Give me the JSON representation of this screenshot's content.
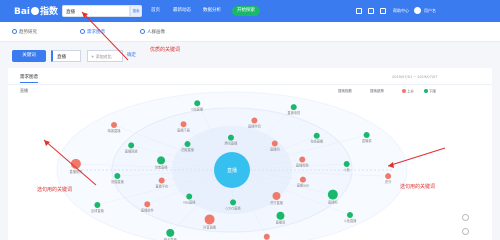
{
  "topbar": {
    "logo_text": "Baidu 指数",
    "search_value": "直播",
    "search_button": "搜索",
    "nav": [
      "首页",
      "最新动态",
      "数据分析"
    ],
    "cta": "开始探索",
    "help": "帮助中心",
    "user": "用户名"
  },
  "subnav": {
    "items": [
      "趋势研究",
      "需求图谱",
      "人群画像"
    ]
  },
  "keywords": {
    "button": "关键词",
    "tag": "直播",
    "add_placeholder": "+ 添加对比",
    "confirm": "确定"
  },
  "panel": {
    "tab": "需求图谱",
    "subtitle": "直播",
    "date_range": "2019/07/01 ~ 2019/07/07",
    "legend": [
      "搜索指数",
      "搜索趋势"
    ],
    "legend_up": "上升",
    "legend_down": "下降"
  },
  "annotations": {
    "top": "优质的关键词",
    "left": "选句用的关键词",
    "right": "选句用的关键词"
  },
  "colors": {
    "brand": "#3a7bf0",
    "rise": "#f07a6a",
    "fall": "#1bb86c",
    "annotation": "#e03030"
  },
  "graph": {
    "center": "直播",
    "nodes": [
      {
        "label": "直播app",
        "trend": "rise",
        "size": 3
      },
      {
        "label": "直播吧",
        "trend": "fall",
        "size": 5
      },
      {
        "label": "斗鱼直播",
        "trend": "fall",
        "size": 3
      },
      {
        "label": "虎牙直播",
        "trend": "rise",
        "size": 4
      },
      {
        "label": "直播间",
        "trend": "fall",
        "size": 4
      },
      {
        "label": "体育直播",
        "trend": "rise",
        "size": 3
      },
      {
        "label": "cctv5直播",
        "trend": "fall",
        "size": 3
      },
      {
        "label": "抖音直播",
        "trend": "rise",
        "size": 5
      },
      {
        "label": "快手直播",
        "trend": "fall",
        "size": 4
      },
      {
        "label": "nba直播",
        "trend": "fall",
        "size": 3
      },
      {
        "label": "直播软件",
        "trend": "rise",
        "size": 3
      },
      {
        "label": "足球直播",
        "trend": "fall",
        "size": 3
      },
      {
        "label": "直播平台",
        "trend": "rise",
        "size": 3
      },
      {
        "label": "熊猫直播",
        "trend": "fall",
        "size": 3
      },
      {
        "label": "直播带货",
        "trend": "rise",
        "size": 5
      },
      {
        "label": "淘宝直播",
        "trend": "fall",
        "size": 4
      },
      {
        "label": "直播回放",
        "trend": "fall",
        "size": 3
      },
      {
        "label": "映客直播",
        "trend": "rise",
        "size": 3
      },
      {
        "label": "花椒直播",
        "trend": "fall",
        "size": 3
      },
      {
        "label": "直播下载",
        "trend": "rise",
        "size": 3
      },
      {
        "label": "b站直播",
        "trend": "fall",
        "size": 3
      },
      {
        "label": "腾讯直播",
        "trend": "fall",
        "size": 3
      },
      {
        "label": "直播伴侣",
        "trend": "rise",
        "size": 3
      },
      {
        "label": "直播电视",
        "trend": "fall",
        "size": 3
      },
      {
        "label": "直播网",
        "trend": "rise",
        "size": 3
      },
      {
        "label": "在线直播",
        "trend": "fall",
        "size": 3
      },
      {
        "label": "直播源",
        "trend": "fall",
        "size": 3
      },
      {
        "label": "直播视频",
        "trend": "rise",
        "size": 3
      },
      {
        "label": "斗鱼",
        "trend": "fall",
        "size": 3
      },
      {
        "label": "虎牙",
        "trend": "rise",
        "size": 3
      }
    ]
  }
}
